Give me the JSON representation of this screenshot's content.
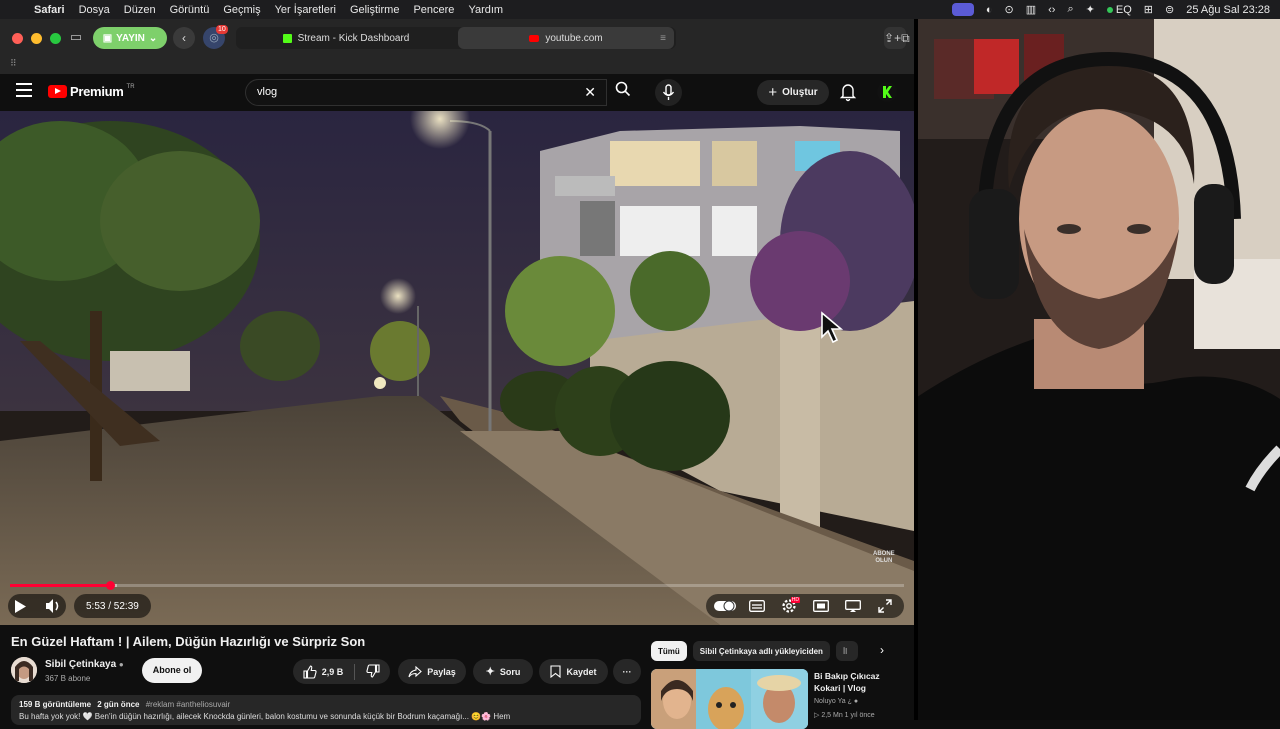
{
  "menubar": {
    "app": "Safari",
    "items": [
      "Dosya",
      "Düzen",
      "Görüntü",
      "Geçmiş",
      "Yer İşaretleri",
      "Geliştirme",
      "Pencere",
      "Yardım"
    ],
    "eq_label": "EQ",
    "datetime": "25 Ağu Sal  23:28"
  },
  "safari": {
    "yayin_label": "YAYIN",
    "ext_badge": "10",
    "tabs": [
      {
        "title": "Stream - Kick Dashboard"
      },
      {
        "title": "youtube.com"
      }
    ]
  },
  "youtube": {
    "logo_text": "Premium",
    "logo_region": "TR",
    "search": {
      "value": "vlog"
    },
    "create_label": "Oluştur"
  },
  "player": {
    "current_time": "5:53",
    "duration": "52:39",
    "time_display": "5:53 / 52:39",
    "played_fraction": 0.1118,
    "buffered_fraction": 0.12,
    "watermark_line1": "ABONE",
    "watermark_line2": "OLUN",
    "quality_badge": "HD"
  },
  "video": {
    "title": "En Güzel Haftam ! | Ailem, Düğün Hazırlığı ve Sürpriz Son",
    "channel": "Sibil Çetinkaya",
    "subscribers": "367 B abone",
    "subscribe_label": "Abone ol",
    "likes": "2,9 B",
    "share_label": "Paylaş",
    "ask_label": "Soru",
    "save_label": "Kaydet",
    "more_label": "···",
    "views": "159 B görüntüleme",
    "age": "2 gün önce",
    "tags": "#reklam #antheliosuvair",
    "description_line": "Bu hafta yok yok! 🤍 Ben'in düğün hazırlığı, ailecek Knockda günleri, balon kostumu ve sonunda küçük bir Bodrum kaçamağı... 😊🌸 Hem"
  },
  "sidebar": {
    "chips": [
      "Tümü",
      "Sibil Çetinkaya adlı yükleyiciden",
      "İl"
    ],
    "rec": {
      "title": "Bi Bakıp Çıkıcaz Kokari | Vlog",
      "channel": "Noluyo Ya ¿",
      "meta": "▷ 2,5 Mn  1 yıl önce"
    }
  },
  "colors": {
    "yt_red": "#ff0000",
    "progress_red": "#ff0033",
    "kick_green": "#53fc18",
    "yayin_green": "#7ed06b"
  }
}
